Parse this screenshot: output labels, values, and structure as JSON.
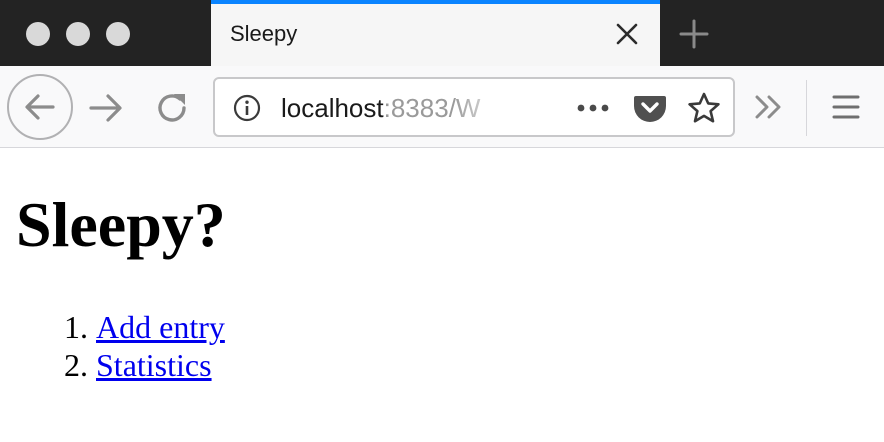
{
  "browser": {
    "tab": {
      "title": "Sleepy"
    },
    "address_bar": {
      "host": "localhost",
      "rest": ":8383/W"
    },
    "colors": {
      "tab_accent": "#0a84ff",
      "titlebar_bg": "#232323",
      "toolbar_bg": "#f9f9fa"
    },
    "icons": {
      "tab_close": "close-icon",
      "new_tab": "plus-icon",
      "back": "arrow-left-icon",
      "forward": "arrow-right-icon",
      "reload": "reload-icon",
      "site_info": "info-icon",
      "page_actions": "more-horizontal-icon",
      "pocket": "pocket-icon",
      "bookmark": "star-icon",
      "overflow": "double-chevron-right-icon",
      "menu": "hamburger-icon"
    }
  },
  "page": {
    "heading": "Sleepy?",
    "links": [
      {
        "label": "Add entry"
      },
      {
        "label": "Statistics"
      }
    ]
  }
}
